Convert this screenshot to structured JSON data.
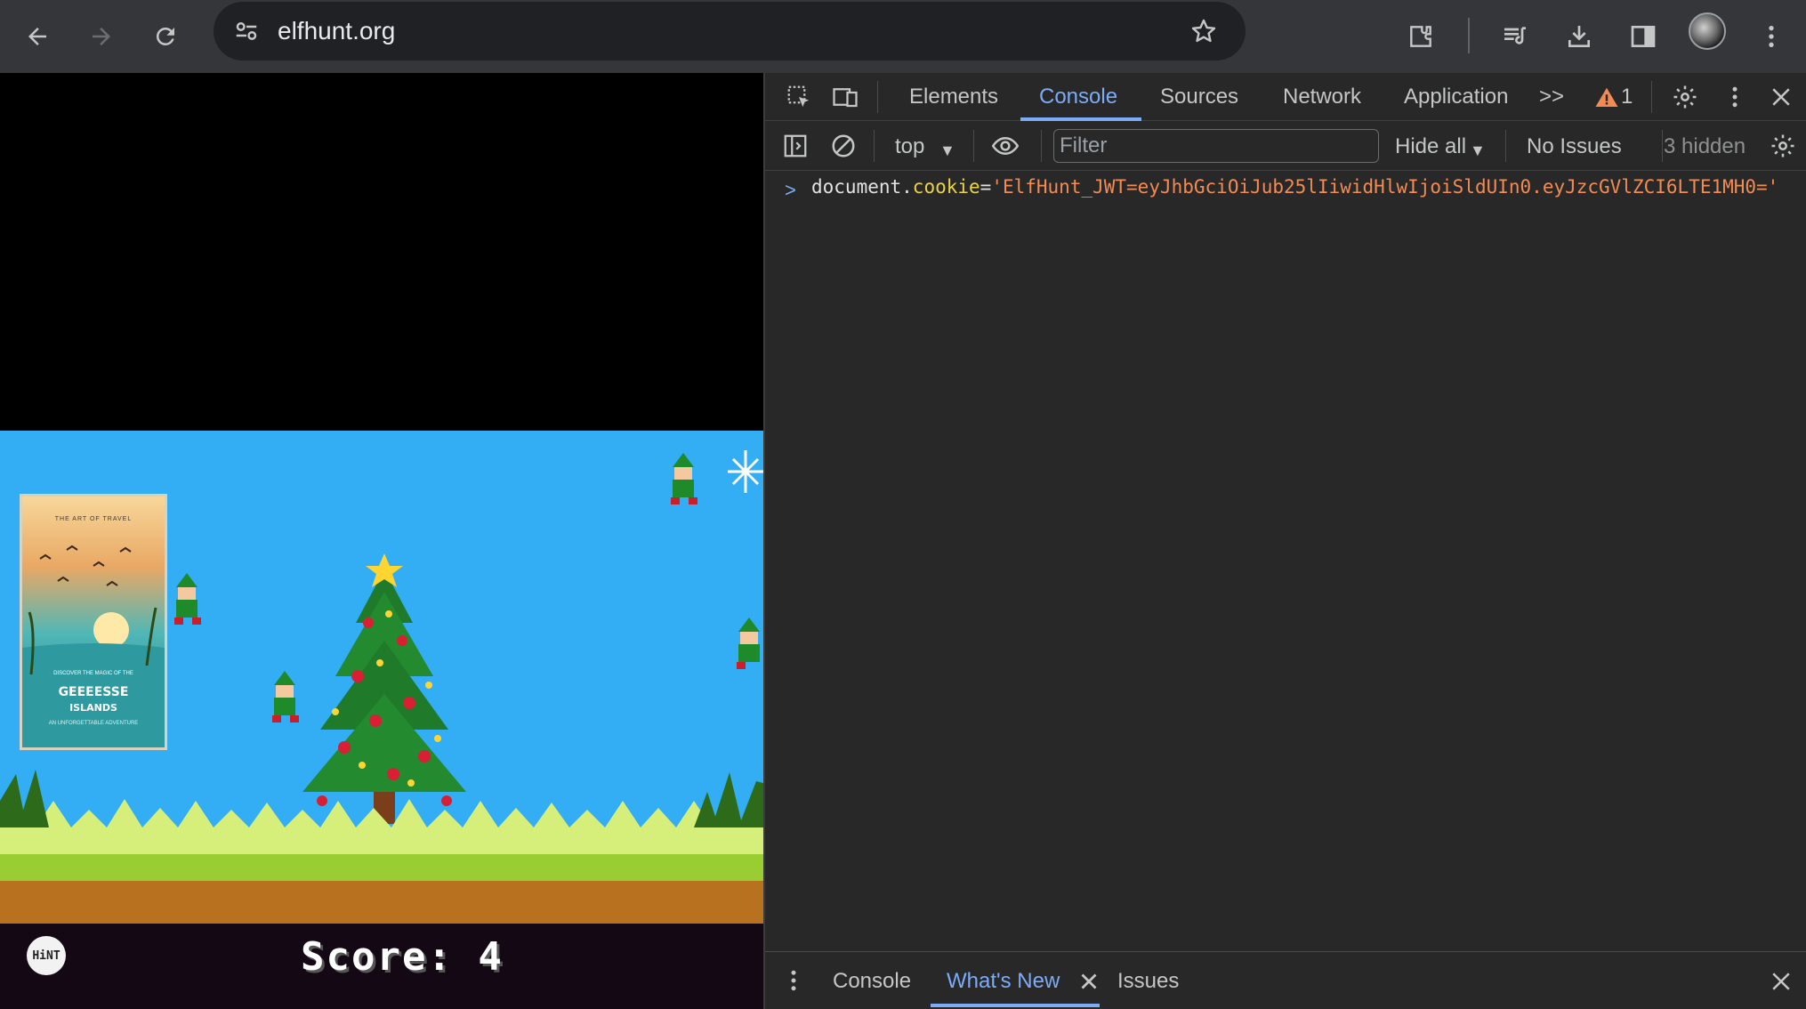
{
  "browser": {
    "url": "elfhunt.org",
    "icons": [
      "back-arrow-icon",
      "forward-arrow-icon",
      "reload-icon",
      "site-settings-icon",
      "star-icon",
      "extensions-icon",
      "reading-list-icon",
      "download-icon",
      "side-panel-icon",
      "profile-avatar",
      "more-vert-icon"
    ]
  },
  "game": {
    "score_text": "Score: 4",
    "hint_label": "HiNT",
    "poster": {
      "top_text": "THE ART OF TRAVEL",
      "sub_text": "DISCOVER THE MAGIC OF THE",
      "title_line1": "GEEEESSE",
      "title_line2": "ISLANDS",
      "foot_text": "AN UNFORGETTABLE ADVENTURE"
    },
    "colors": {
      "sky": "#33aef5",
      "grass": "#9acd32",
      "dirt": "#b8721f"
    }
  },
  "devtools": {
    "tabs": [
      {
        "label": "Elements"
      },
      {
        "label": "Console"
      },
      {
        "label": "Sources"
      },
      {
        "label": "Network"
      },
      {
        "label": "Application"
      }
    ],
    "more_tabs": ">>",
    "warning_count": "1",
    "console_bar": {
      "context": "top",
      "filter_placeholder": "Filter",
      "levels": "Hide all",
      "issues": "No Issues",
      "hidden": "3 hidden"
    },
    "console_entry": {
      "prompt": ">",
      "object": "document.",
      "property": "cookie",
      "equals": "=",
      "value": "'ElfHunt_JWT=eyJhbGciOiJub25lIiwidHlwIjoiSldUIn0.eyJzcGVlZCI6LTE1MH0='"
    },
    "drawer": {
      "tabs": [
        {
          "label": "Console"
        },
        {
          "label": "What's New"
        },
        {
          "label": "Issues"
        }
      ]
    },
    "accent": "#7cacf8"
  }
}
